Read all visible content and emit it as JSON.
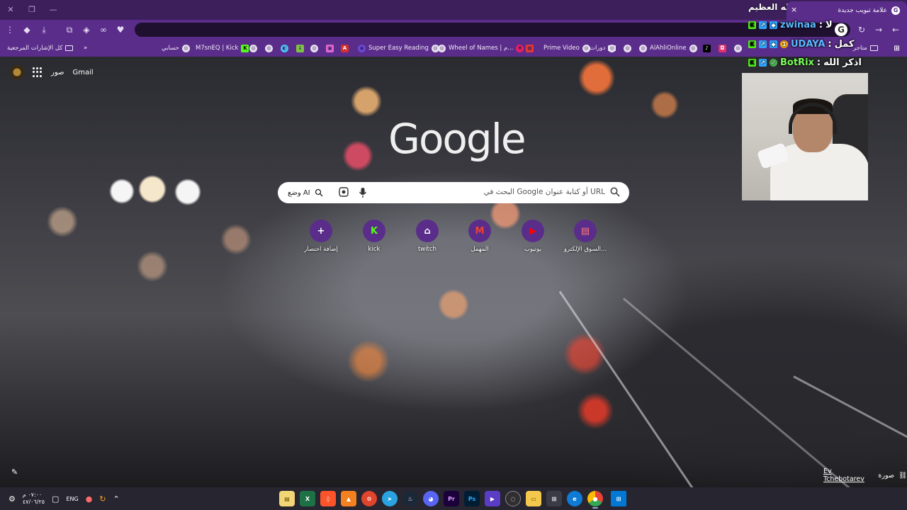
{
  "window": {
    "controls": {
      "close": "✕",
      "restore": "❐",
      "minimize": "—"
    }
  },
  "tab": {
    "title": "علامة تبويب جديدة",
    "close": "×"
  },
  "overlay_title": "الله العظيم",
  "toolbar": {
    "icons": [
      "menu-icon",
      "profile-icon",
      "download-icon",
      "extensions-icon",
      "extension-icon",
      "extension-icon",
      "extension-icon",
      "reload-icon",
      "forward-icon",
      "back-icon"
    ]
  },
  "bookmarks": {
    "all_bookmarks": "كل الإشارات المرجعية",
    "items": [
      "حسابي",
      "M7snEQ | Kick",
      "Super Easy Reading",
      "Wheel of Names | م...",
      "Prime Video",
      "دورات",
      "AlAhliOnline",
      "متاجر"
    ]
  },
  "ntp": {
    "gmail": "Gmail",
    "images": "صور",
    "logo": "Google",
    "search_placeholder": "البحث في Google أو كتابة عنوان URL",
    "ai_mode": "وضع AI",
    "shortcuts": [
      {
        "label": "إضافة اختصار",
        "icon": "+"
      },
      {
        "label": "kick",
        "icon": "K"
      },
      {
        "label": "twitch",
        "icon": "⌂"
      },
      {
        "label": "المهمل",
        "icon": "M"
      },
      {
        "label": "يوتيوب",
        "icon": "▶"
      },
      {
        "label": "السوق الإلكترو...",
        "icon": "▤"
      }
    ],
    "photo_credit_prefix": "صورة",
    "photo_credit_author": "Ev Tchebotarev"
  },
  "chat": [
    {
      "user": "zwinaa",
      "message": "لا"
    },
    {
      "user": "UDAYA",
      "message": "كمل"
    },
    {
      "user": "BotRix",
      "message": "اذكر الله"
    }
  ],
  "taskbar": {
    "time": "٠٧:٠٠ م",
    "date": "٤٧/٠٦/٢٥",
    "lang": "ENG",
    "apps": [
      "file-explorer",
      "excel",
      "brave",
      "vlc",
      "app-red",
      "telegram",
      "steam",
      "discord",
      "premiere",
      "photoshop",
      "app-purple",
      "obs",
      "folder",
      "store",
      "edge",
      "chrome",
      "windows"
    ]
  }
}
